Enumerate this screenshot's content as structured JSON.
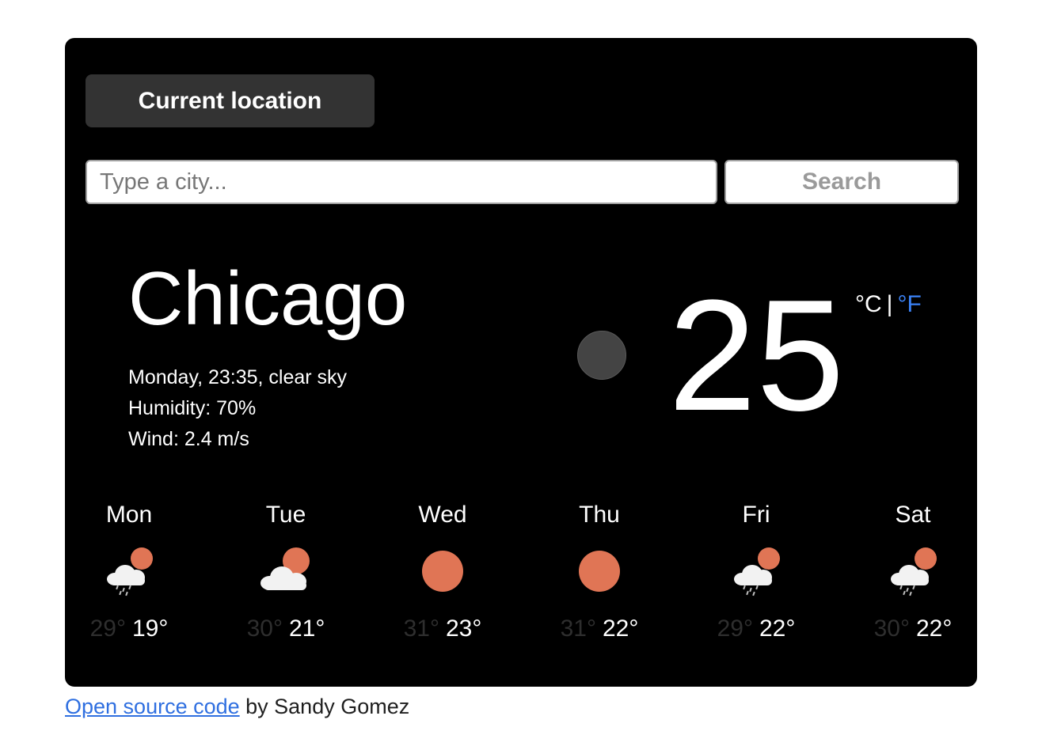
{
  "location_button": {
    "label": "Current location"
  },
  "search": {
    "placeholder": "Type a city...",
    "value": "",
    "button_label": "Search"
  },
  "current": {
    "city": "Chicago",
    "datetime_desc": "Monday, 23:35, clear sky",
    "humidity": "Humidity: 70%",
    "wind": "Wind: 2.4 m/s",
    "temperature": "25",
    "unit_c": "°C",
    "unit_sep": "|",
    "unit_f": "°F",
    "icon": "moon-icon"
  },
  "forecast": [
    {
      "day": "Mon",
      "icon": "rain-cloud-sun-icon",
      "high": "29°",
      "low": "19°"
    },
    {
      "day": "Tue",
      "icon": "cloud-sun-icon",
      "high": "30°",
      "low": "21°"
    },
    {
      "day": "Wed",
      "icon": "sun-icon",
      "high": "31°",
      "low": "23°"
    },
    {
      "day": "Thu",
      "icon": "sun-icon",
      "high": "31°",
      "low": "22°"
    },
    {
      "day": "Fri",
      "icon": "rain-cloud-sun-icon",
      "high": "29°",
      "low": "22°"
    },
    {
      "day": "Sat",
      "icon": "rain-cloud-sun-icon",
      "high": "30°",
      "low": "22°"
    }
  ],
  "footer": {
    "link_text": "Open source code",
    "suffix": " by Sandy Gomez"
  },
  "colors": {
    "accent": "#3b82f6",
    "sun": "#e07555",
    "card_bg": "#000000",
    "button_bg": "#333333"
  }
}
